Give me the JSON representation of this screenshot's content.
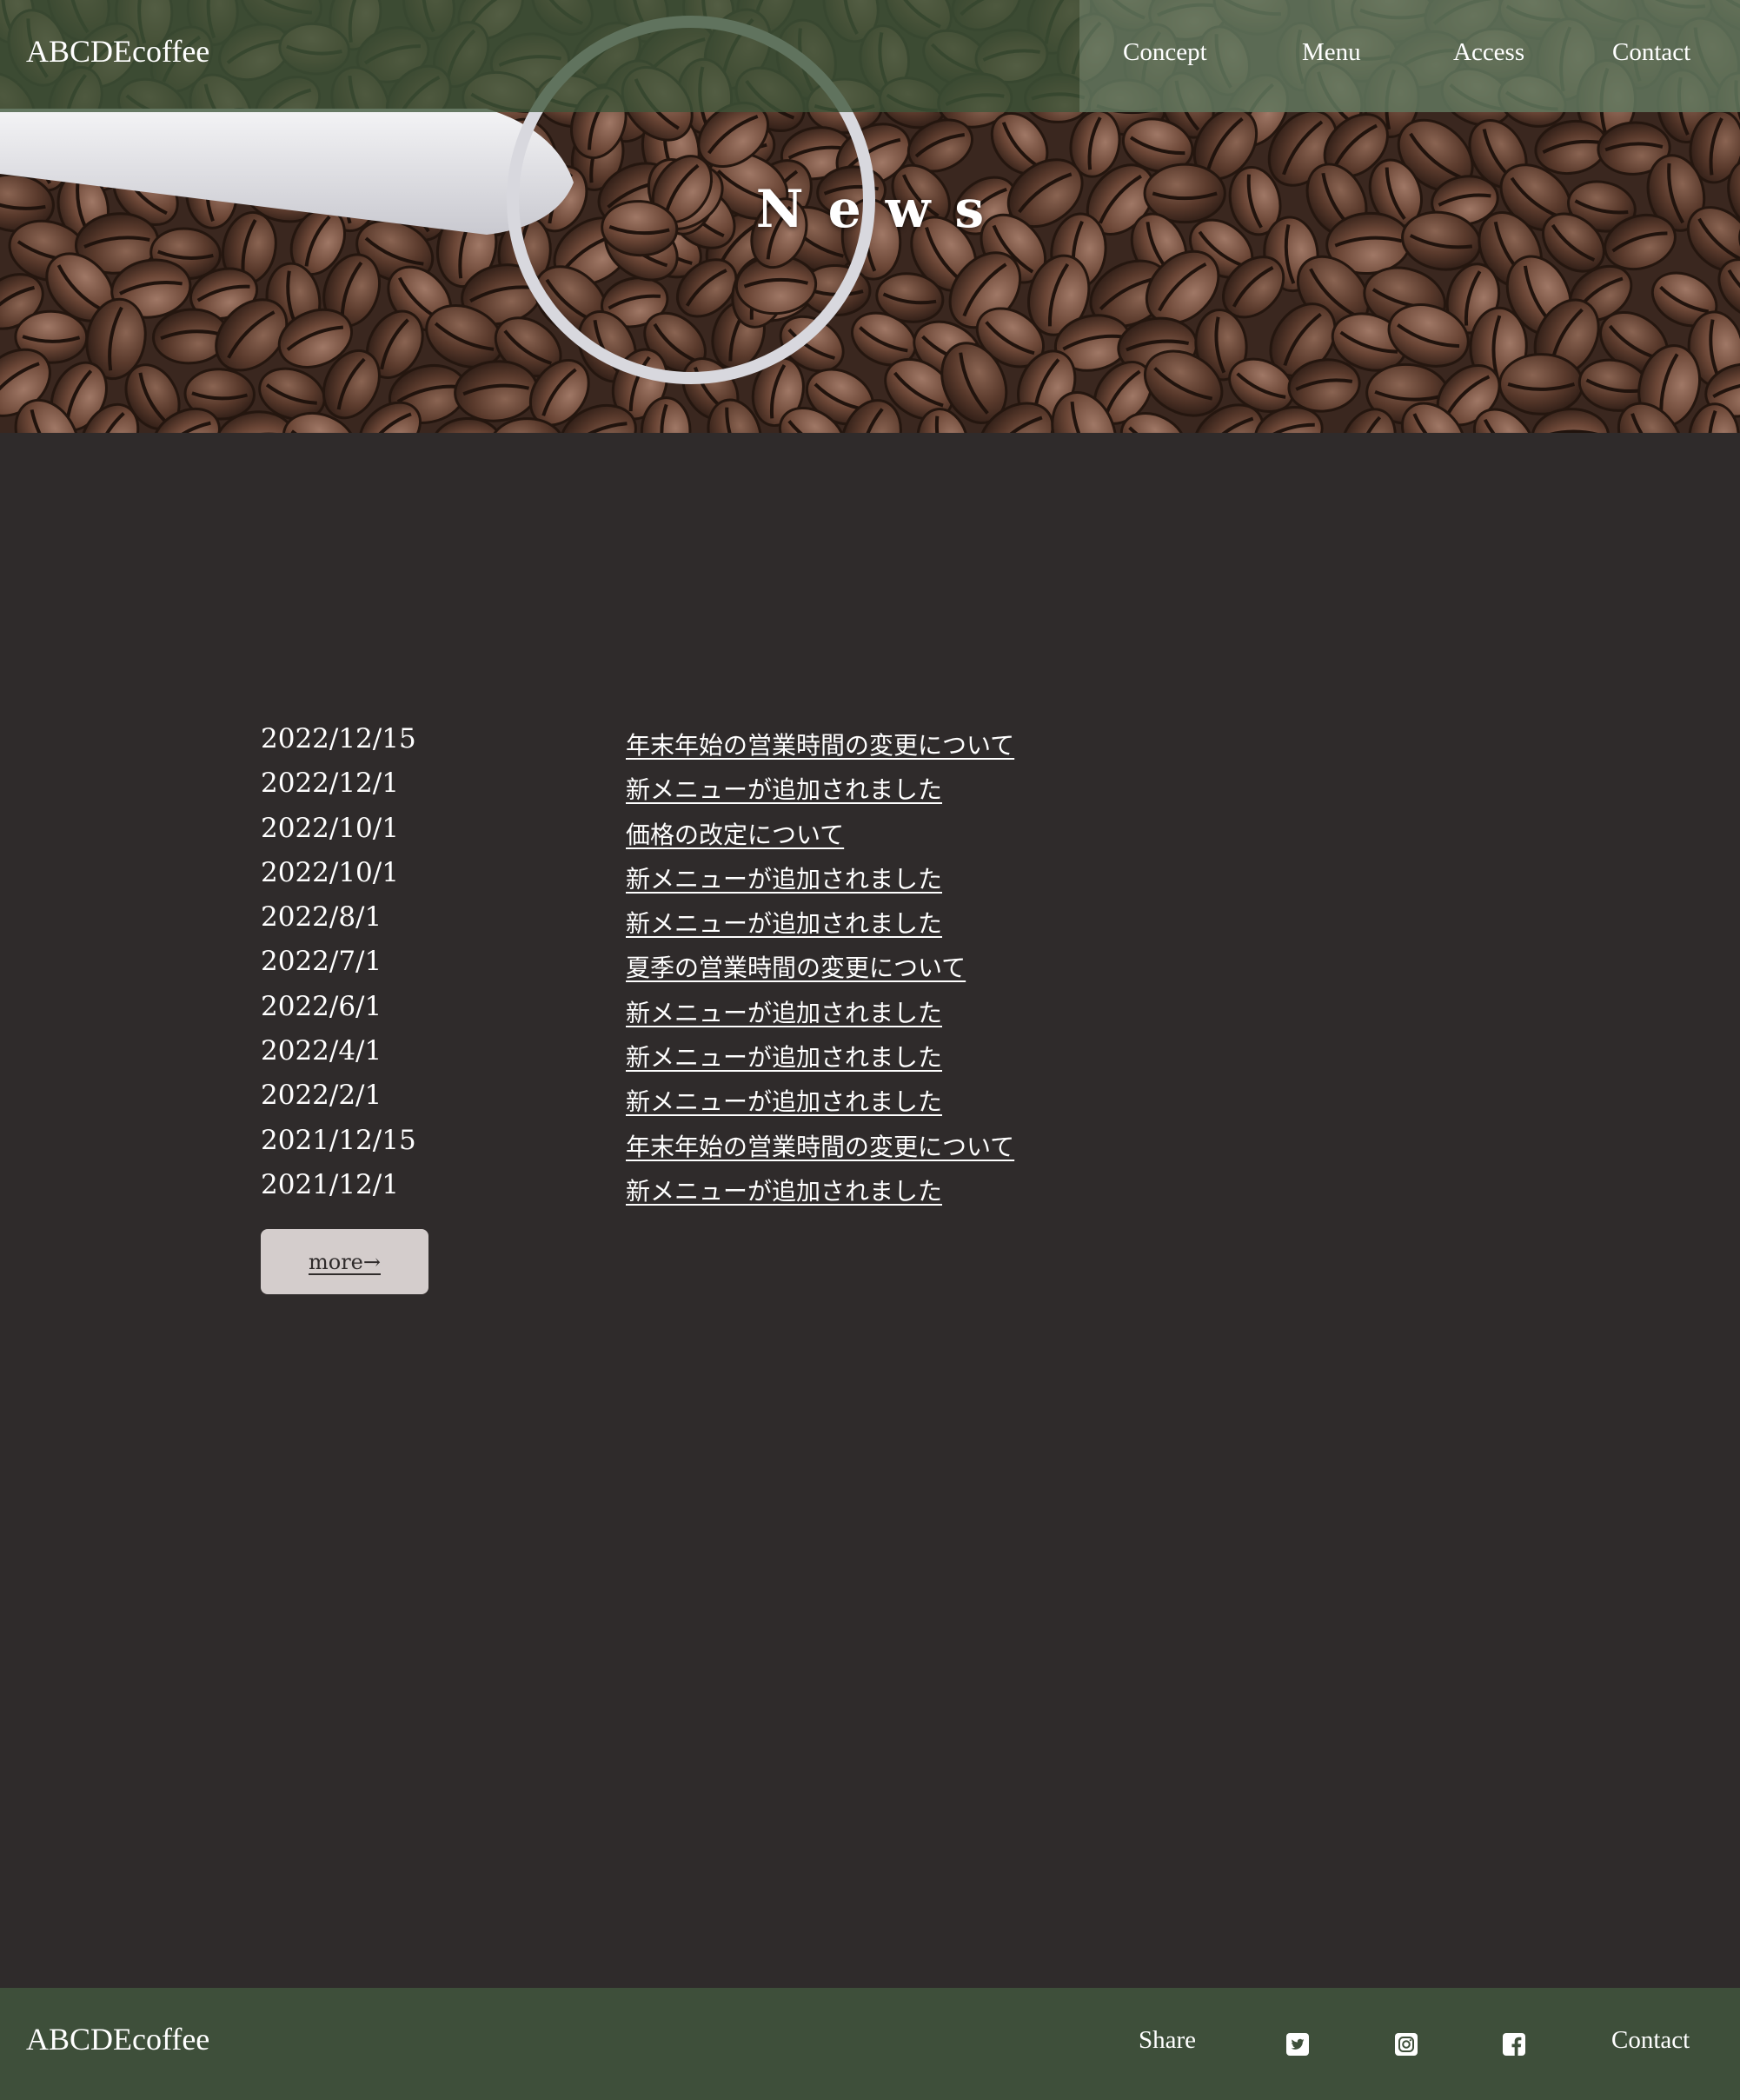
{
  "header": {
    "logo": "ABCDEcoffee",
    "nav": [
      {
        "label": "Concept"
      },
      {
        "label": "Menu"
      },
      {
        "label": "Access"
      },
      {
        "label": "Contact"
      }
    ]
  },
  "banner": {
    "title": "News"
  },
  "news": {
    "items": [
      {
        "date": "2022/12/15",
        "title": "年末年始の営業時間の変更について"
      },
      {
        "date": "2022/12/1",
        "title": "新メニューが追加されました"
      },
      {
        "date": "2022/10/1",
        "title": "価格の改定について"
      },
      {
        "date": "2022/10/1",
        "title": "新メニューが追加されました"
      },
      {
        "date": "2022/8/1",
        "title": "新メニューが追加されました"
      },
      {
        "date": "2022/7/1",
        "title": "夏季の営業時間の変更について"
      },
      {
        "date": "2022/6/1",
        "title": "新メニューが追加されました"
      },
      {
        "date": "2022/4/1",
        "title": "新メニューが追加されました"
      },
      {
        "date": "2022/2/1",
        "title": "新メニューが追加されました"
      },
      {
        "date": "2021/12/15",
        "title": "年末年始の営業時間の変更について"
      },
      {
        "date": "2021/12/1",
        "title": "新メニューが追加されました"
      }
    ],
    "more_label": "more→"
  },
  "footer": {
    "logo": "ABCDEcoffee",
    "share_label": "Share",
    "social_icons": [
      "twitter-icon",
      "instagram-icon",
      "facebook-icon"
    ],
    "contact_label": "Contact"
  },
  "colors": {
    "page_bg": "#2f2b2b",
    "header_green": "#3e563a",
    "footer_green": "#3e4f3a",
    "more_button_bg": "#d4cdcc",
    "text": "#ffffff"
  }
}
